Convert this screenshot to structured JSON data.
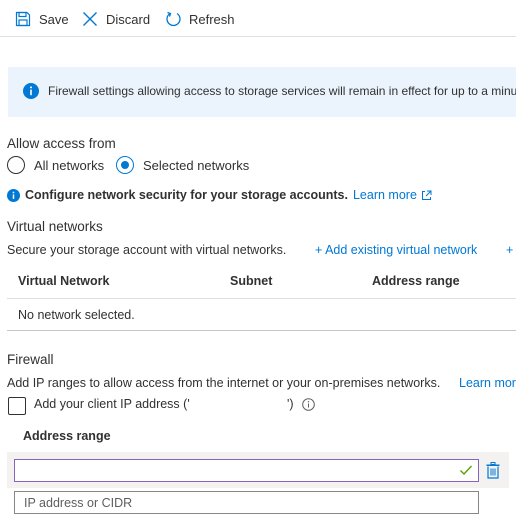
{
  "toolbar": {
    "save_label": "Save",
    "save_icon": "save-icon",
    "discard_label": "Discard",
    "discard_icon": "close-icon",
    "refresh_label": "Refresh",
    "refresh_icon": "refresh-icon"
  },
  "banner": {
    "icon": "info-icon",
    "text": "Firewall settings allowing access to storage services will remain in effect for up to a minut"
  },
  "access": {
    "label": "Allow access from",
    "options": [
      {
        "label": "All networks",
        "selected": false
      },
      {
        "label": "Selected networks",
        "selected": true
      }
    ]
  },
  "security_info": {
    "text": "Configure network security for your storage accounts.",
    "link": "Learn more",
    "link_icon": "external-link-icon"
  },
  "virtual_networks": {
    "title": "Virtual networks",
    "description": "Secure your storage account with virtual networks.",
    "add_existing": "+ Add existing virtual network",
    "add_new_partial": "+",
    "columns": [
      "Virtual Network",
      "Subnet",
      "Address range"
    ],
    "empty_text": "No network selected."
  },
  "firewall": {
    "title": "Firewall",
    "description": "Add IP ranges to allow access from the internet or your on-premises networks.",
    "learn_more_partial": "Learn mor",
    "client_ip_prefix": "Add your client IP address ('",
    "client_ip_suffix": "')",
    "client_ip_checked": false,
    "address_range_header": "Address range",
    "address_input_value": "",
    "address_placeholder": "IP address or CIDR"
  },
  "colors": {
    "accent": "#0078d4",
    "banner_bg": "#ebf3fc",
    "valid_check": "#57a300",
    "active_border": "#8764b8"
  }
}
